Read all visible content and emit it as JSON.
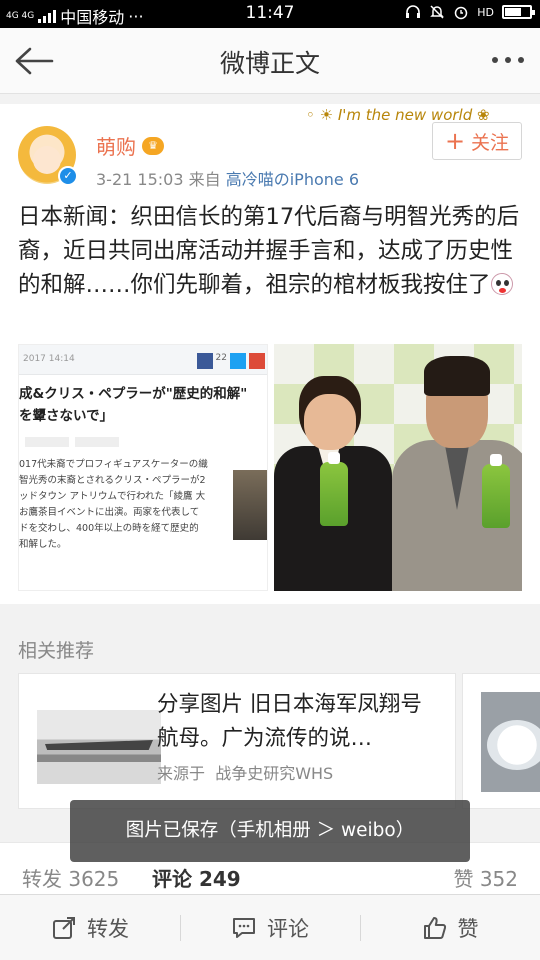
{
  "status_bar": {
    "network": "4G 4G",
    "carrier": "中国移动",
    "more": "···",
    "time": "11:47",
    "hd": "HD"
  },
  "nav": {
    "title": "微博正文"
  },
  "post": {
    "user": {
      "name": "萌购",
      "verified": true,
      "vip_badge": "vip-crown-icon"
    },
    "date": "3-21",
    "time": "15:03",
    "source_prefix": "来自",
    "source": "高冷喵のiPhone 6",
    "decoration_text": "I'm the new world",
    "follow_label": "关注",
    "follow_plus": "+",
    "text": "日本新闻：织田信长的第17代后裔与明智光秀的后裔，近日共同出席活动并握手言和，达成了历史性的和解……你们先聊着，祖宗的棺材板我按住了",
    "images": [
      {
        "kind": "news-screenshot",
        "header_date": "2017 14:14",
        "share_count": "22",
        "headline_line1": "成&クリス・ペプラーが\"歴史的和解\"",
        "headline_line2": "を顰さないで」",
        "body_lines": [
          "017代未裔でプロフィギュアスケーターの織",
          "智光秀の末裔とされるクリス・ペプラーが2",
          "ッドタウン アトリウムで行われた「綾鷹 大",
          "お鷹茶目イベントに出演。両家を代表して",
          "ドを交わし、400年以上の時を経て歴史的",
          "和解した。"
        ]
      },
      {
        "kind": "photo-two-men-handshake"
      }
    ]
  },
  "related": {
    "label": "相关推荐",
    "cards": [
      {
        "title": "分享图片 旧日本海军凤翔号航母。广为流传的说…",
        "source_prefix": "来源于",
        "source": "战争史研究WHS"
      }
    ]
  },
  "toast": {
    "text": "图片已保存（手机相册 ＞ weibo）"
  },
  "stats": {
    "repost_label": "转发",
    "repost_count": "3625",
    "comment_label": "评论",
    "comment_count": "249",
    "like_label": "赞",
    "like_count": "352"
  },
  "bottom_bar": {
    "repost": "转发",
    "comment": "评论",
    "like": "赞"
  },
  "colors": {
    "accent": "#eb7350",
    "link": "#4a7ab0",
    "verified": "#1e8ee8"
  }
}
